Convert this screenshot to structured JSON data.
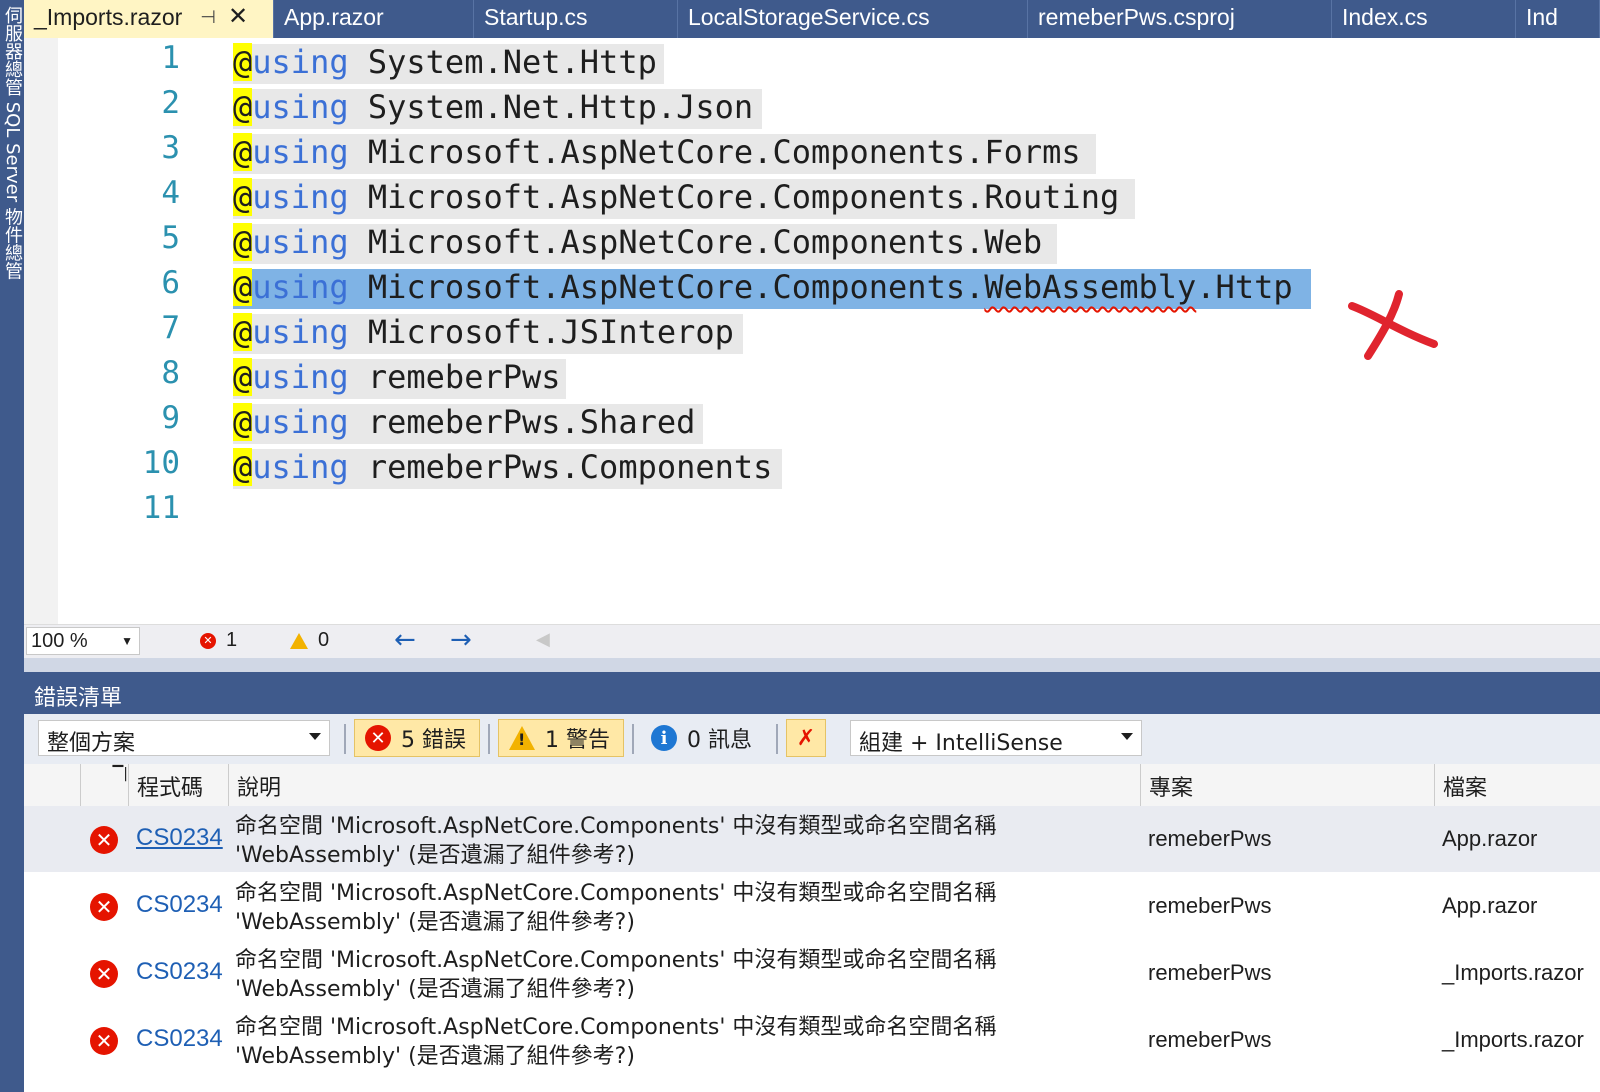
{
  "left_strip": {
    "text": "伺服器總管 SQL Server 物件總管"
  },
  "tabs": [
    {
      "label": "_Imports.razor",
      "active": true
    },
    {
      "label": "App.razor"
    },
    {
      "label": "Startup.cs"
    },
    {
      "label": "LocalStorageService.cs"
    },
    {
      "label": "remeberPws.csproj"
    },
    {
      "label": "Index.cs"
    },
    {
      "label": "Ind"
    }
  ],
  "editor": {
    "lines": [
      {
        "n": "1",
        "at": "@",
        "kw": "using",
        "ns": " System.Net.Http"
      },
      {
        "n": "2",
        "at": "@",
        "kw": "using",
        "ns": " System.Net.Http.Json"
      },
      {
        "n": "3",
        "at": "@",
        "kw": "using",
        "ns": " Microsoft.AspNetCore.Components.Forms"
      },
      {
        "n": "4",
        "at": "@",
        "kw": "using",
        "ns": " Microsoft.AspNetCore.Components.Routing"
      },
      {
        "n": "5",
        "at": "@",
        "kw": "using",
        "ns": " Microsoft.AspNetCore.Components.Web"
      },
      {
        "n": "6",
        "at": "@",
        "kw": "using",
        "ns": " Microsoft.AspNetCore.Components.",
        "ns_err": "WebAssembly",
        "ns_tail": ".Http"
      },
      {
        "n": "7",
        "at": "@",
        "kw": "using",
        "ns": " Microsoft.JSInterop"
      },
      {
        "n": "8",
        "at": "@",
        "kw": "using",
        "ns": " remeberPws"
      },
      {
        "n": "9",
        "at": "@",
        "kw": "using",
        "ns": " remeberPws.Shared"
      },
      {
        "n": "10",
        "at": "@",
        "kw": "using",
        "ns": " remeberPws.Components"
      },
      {
        "n": "11"
      }
    ]
  },
  "status": {
    "zoom": "100 %",
    "errors": "1",
    "warnings": "0"
  },
  "error_list": {
    "title": "錯誤清單",
    "scope": "整個方案",
    "errors_btn": "5 錯誤",
    "warnings_btn": "1 警告",
    "messages_btn": "0 訊息",
    "build_filter": "組建 + IntelliSense",
    "columns": [
      "程式碼",
      "說明",
      "專案",
      "檔案"
    ],
    "rows": [
      {
        "code": "CS0234",
        "desc1": "命名空間 'Microsoft.AspNetCore.Components' 中沒有類型或命名空間名稱",
        "desc2": "'WebAssembly' (是否遺漏了組件參考?)",
        "project": "remeberPws",
        "file": "App.razor"
      },
      {
        "code": "CS0234",
        "desc1": "命名空間 'Microsoft.AspNetCore.Components' 中沒有類型或命名空間名稱",
        "desc2": "'WebAssembly' (是否遺漏了組件參考?)",
        "project": "remeberPws",
        "file": "App.razor"
      },
      {
        "code": "CS0234",
        "desc1": "命名空間 'Microsoft.AspNetCore.Components' 中沒有類型或命名空間名稱",
        "desc2": "'WebAssembly' (是否遺漏了組件參考?)",
        "project": "remeberPws",
        "file": "_Imports.razor"
      },
      {
        "code": "CS0234",
        "desc1": "命名空間 'Microsoft.AspNetCore.Components' 中沒有類型或命名空間名稱",
        "desc2": "'WebAssembly' (是否遺漏了組件參考?)",
        "project": "remeberPws",
        "file": "_Imports.razor"
      }
    ]
  },
  "colors": {
    "accent": "#3f5a8c",
    "selection": "#7fb3e5",
    "error": "#e51400",
    "warning": "#f2b200"
  }
}
